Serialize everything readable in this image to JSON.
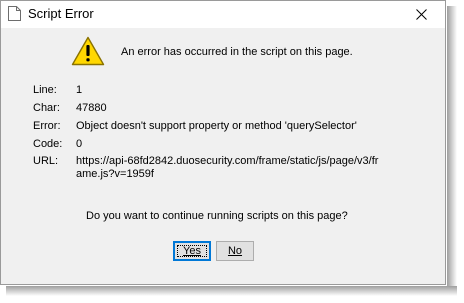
{
  "window": {
    "title": "Script Error",
    "close_icon": "close-icon"
  },
  "dialog": {
    "icon": "warning-icon",
    "message": "An error has occurred in the script on this page.",
    "details": [
      {
        "key": "Line:",
        "value": "1"
      },
      {
        "key": "Char:",
        "value": "47880"
      },
      {
        "key": "Error:",
        "value": "Object doesn't support property or method 'querySelector'"
      },
      {
        "key": "Code:",
        "value": "0"
      },
      {
        "key": "URL:",
        "value": "https://api-68fd2842.duosecurity.com/frame/static/js/page/v3/frame.js?v=1959f"
      }
    ],
    "question": "Do you want to continue running scripts on this page?",
    "yes_label": "Yes",
    "no_label": "No"
  }
}
